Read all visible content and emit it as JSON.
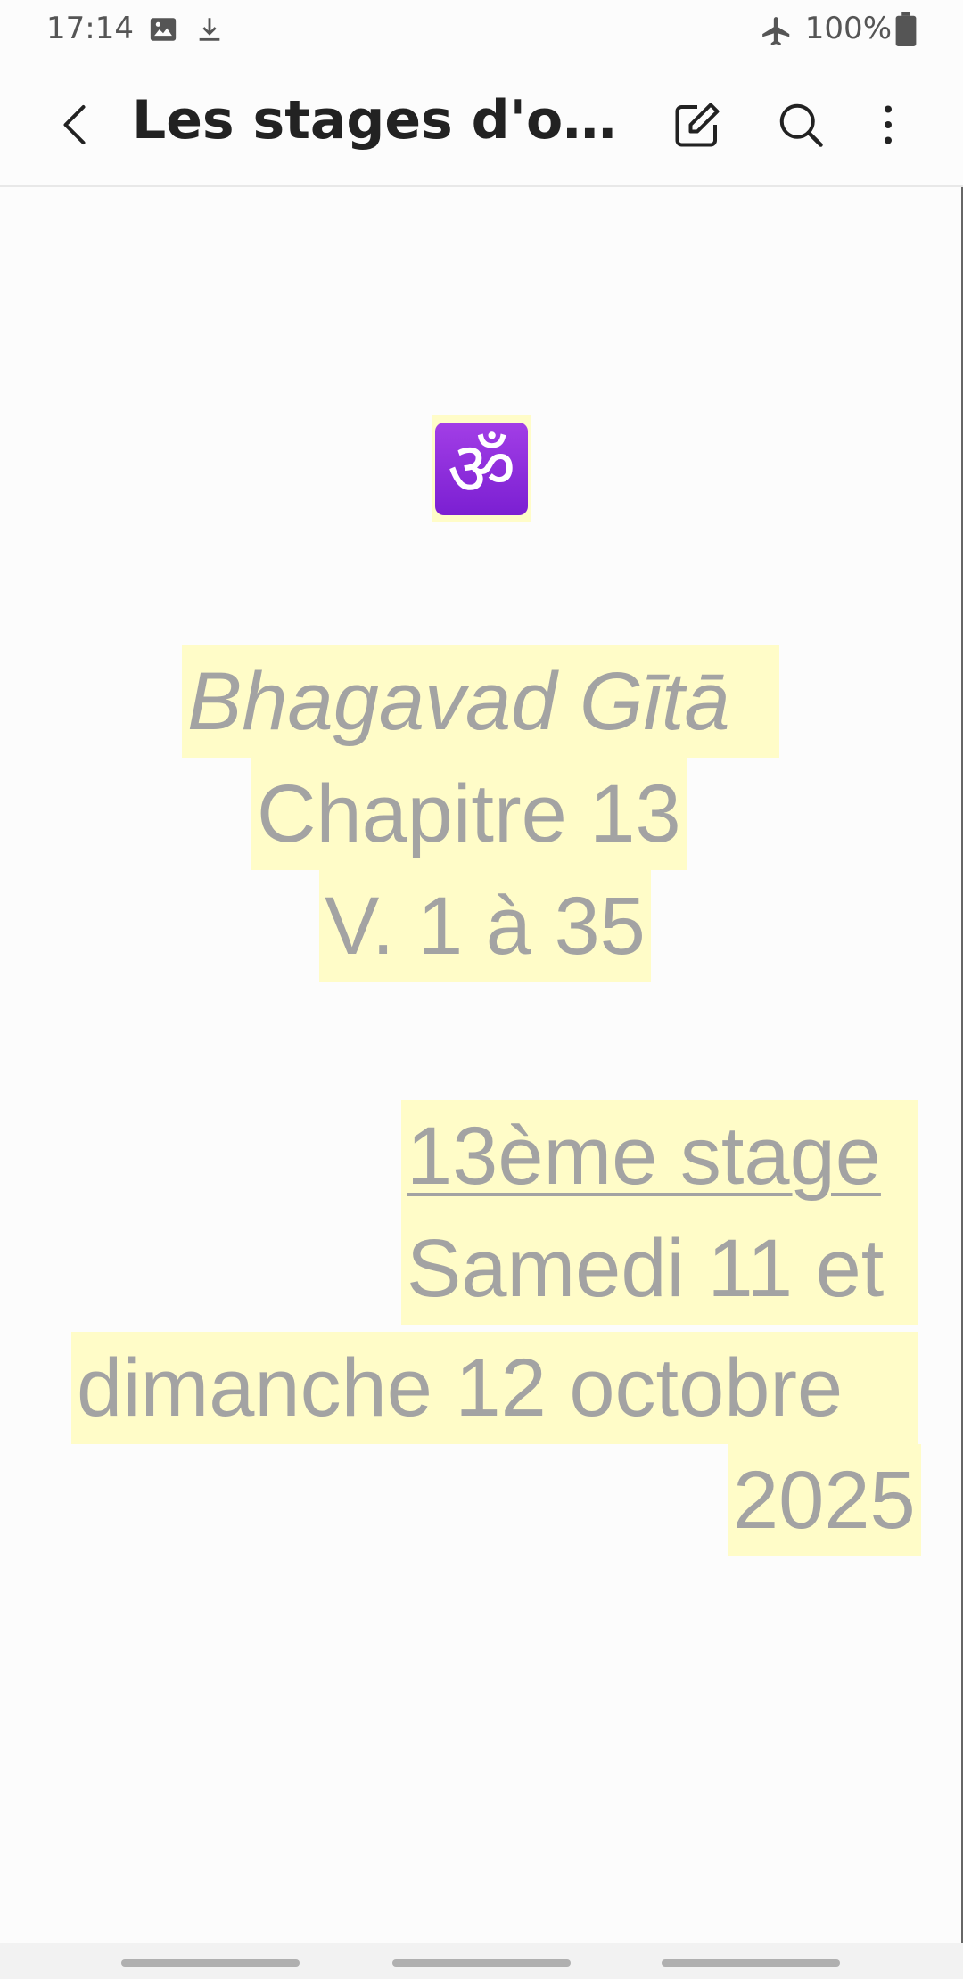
{
  "status_bar": {
    "time": "17:14",
    "icons": [
      "image-icon",
      "download-icon",
      "airplane-icon",
      "battery-icon"
    ],
    "battery": "100%"
  },
  "app_bar": {
    "title": "Les stages d'octo…",
    "actions": [
      "back-icon",
      "edit-icon",
      "search-icon",
      "more-vert-icon"
    ]
  },
  "note": {
    "om_symbol": "ॐ",
    "lines": [
      "Bhagavad  Gītā",
      "Chapitre  13",
      "V. 1 à 35",
      "13ème stage",
      "Samedi 11 et",
      "dimanche  12 octobre",
      "2025"
    ]
  },
  "colors": {
    "highlight": "#fffcc8",
    "text": "#a3a3a3",
    "om_tile": "#8e2ee0"
  }
}
